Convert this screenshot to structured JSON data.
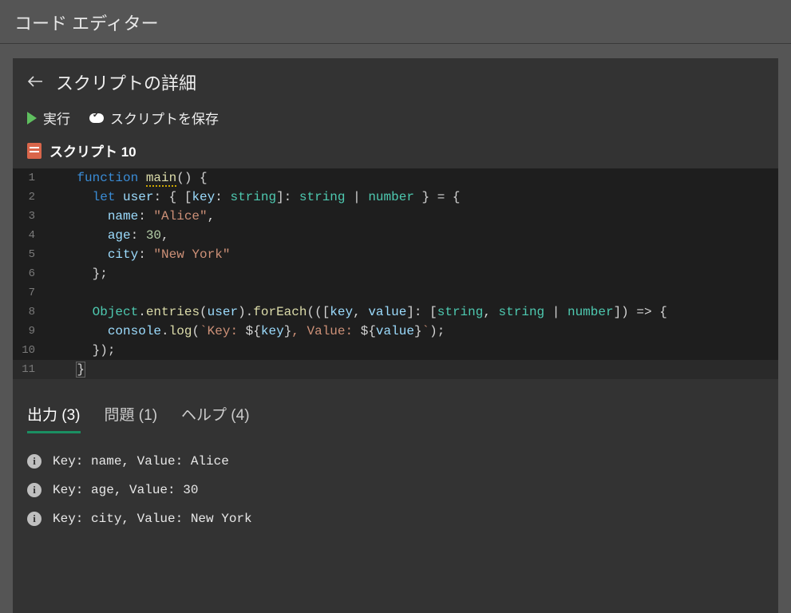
{
  "appTitle": "コード エディター",
  "pageTitle": "スクリプトの詳細",
  "toolbar": {
    "run": "実行",
    "save": "スクリプトを保存"
  },
  "scriptName": "スクリプト 10",
  "code": {
    "lines": [
      {
        "n": "1",
        "tokens": [
          {
            "t": "    ",
            "c": "pun"
          },
          {
            "t": "function",
            "c": "kw"
          },
          {
            "t": " ",
            "c": "pun"
          },
          {
            "t": "main",
            "c": "fn squig"
          },
          {
            "t": "() ",
            "c": "pun"
          },
          {
            "t": "{",
            "c": "pun"
          }
        ]
      },
      {
        "n": "2",
        "tokens": [
          {
            "t": "      ",
            "c": "pun"
          },
          {
            "t": "let",
            "c": "kw"
          },
          {
            "t": " ",
            "c": "pun"
          },
          {
            "t": "user",
            "c": "var"
          },
          {
            "t": ": { [",
            "c": "pun"
          },
          {
            "t": "key",
            "c": "var"
          },
          {
            "t": ": ",
            "c": "pun"
          },
          {
            "t": "string",
            "c": "type"
          },
          {
            "t": "]: ",
            "c": "pun"
          },
          {
            "t": "string",
            "c": "type"
          },
          {
            "t": " | ",
            "c": "pun"
          },
          {
            "t": "number",
            "c": "type"
          },
          {
            "t": " } = {",
            "c": "pun"
          }
        ]
      },
      {
        "n": "3",
        "tokens": [
          {
            "t": "        ",
            "c": "pun"
          },
          {
            "t": "name",
            "c": "var"
          },
          {
            "t": ": ",
            "c": "pun"
          },
          {
            "t": "\"Alice\"",
            "c": "str"
          },
          {
            "t": ",",
            "c": "pun"
          }
        ]
      },
      {
        "n": "4",
        "tokens": [
          {
            "t": "        ",
            "c": "pun"
          },
          {
            "t": "age",
            "c": "var"
          },
          {
            "t": ": ",
            "c": "pun"
          },
          {
            "t": "30",
            "c": "num"
          },
          {
            "t": ",",
            "c": "pun"
          }
        ]
      },
      {
        "n": "5",
        "tokens": [
          {
            "t": "        ",
            "c": "pun"
          },
          {
            "t": "city",
            "c": "var"
          },
          {
            "t": ": ",
            "c": "pun"
          },
          {
            "t": "\"New York\"",
            "c": "str"
          }
        ]
      },
      {
        "n": "6",
        "tokens": [
          {
            "t": "      };",
            "c": "pun"
          }
        ]
      },
      {
        "n": "7",
        "tokens": [
          {
            "t": "",
            "c": "pun"
          }
        ]
      },
      {
        "n": "8",
        "tokens": [
          {
            "t": "      ",
            "c": "pun"
          },
          {
            "t": "Object",
            "c": "id"
          },
          {
            "t": ".",
            "c": "pun"
          },
          {
            "t": "entries",
            "c": "fn"
          },
          {
            "t": "(",
            "c": "pun"
          },
          {
            "t": "user",
            "c": "var"
          },
          {
            "t": ").",
            "c": "pun"
          },
          {
            "t": "forEach",
            "c": "fn"
          },
          {
            "t": "(([",
            "c": "pun"
          },
          {
            "t": "key",
            "c": "var"
          },
          {
            "t": ", ",
            "c": "pun"
          },
          {
            "t": "value",
            "c": "var"
          },
          {
            "t": "]: [",
            "c": "pun"
          },
          {
            "t": "string",
            "c": "type"
          },
          {
            "t": ", ",
            "c": "pun"
          },
          {
            "t": "string",
            "c": "type"
          },
          {
            "t": " | ",
            "c": "pun"
          },
          {
            "t": "number",
            "c": "type"
          },
          {
            "t": "]) => {",
            "c": "pun"
          }
        ]
      },
      {
        "n": "9",
        "tokens": [
          {
            "t": "        ",
            "c": "pun"
          },
          {
            "t": "console",
            "c": "var"
          },
          {
            "t": ".",
            "c": "pun"
          },
          {
            "t": "log",
            "c": "fn"
          },
          {
            "t": "(",
            "c": "pun"
          },
          {
            "t": "`Key: ",
            "c": "str"
          },
          {
            "t": "${",
            "c": "pun"
          },
          {
            "t": "key",
            "c": "var"
          },
          {
            "t": "}",
            "c": "pun"
          },
          {
            "t": ", Value: ",
            "c": "str"
          },
          {
            "t": "${",
            "c": "pun"
          },
          {
            "t": "value",
            "c": "var"
          },
          {
            "t": "}",
            "c": "pun"
          },
          {
            "t": "`",
            "c": "str"
          },
          {
            "t": ");",
            "c": "pun"
          }
        ]
      },
      {
        "n": "10",
        "tokens": [
          {
            "t": "      });",
            "c": "pun"
          }
        ]
      },
      {
        "n": "11",
        "current": true,
        "tokens": [
          {
            "t": "    ",
            "c": "pun"
          },
          {
            "t": "}",
            "c": "pun hl"
          }
        ]
      }
    ]
  },
  "tabs": {
    "output": "出力 (3)",
    "problems": "問題 (1)",
    "help": "ヘルプ (4)"
  },
  "output": [
    "Key: name, Value: Alice",
    "Key: age, Value: 30",
    "Key: city, Value: New York"
  ]
}
